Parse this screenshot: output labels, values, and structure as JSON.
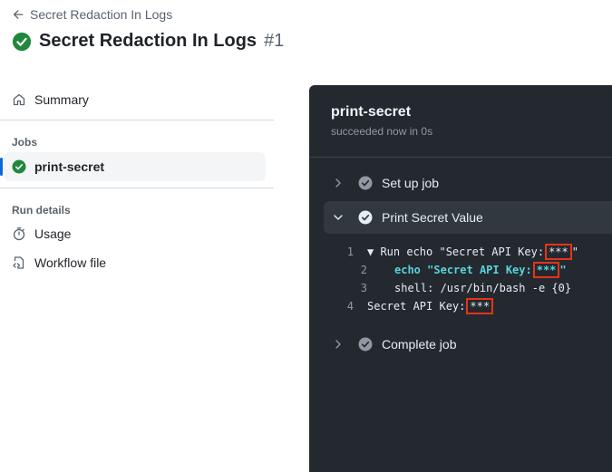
{
  "header": {
    "back_label": "Secret Redaction In Logs",
    "title": "Secret Redaction In Logs",
    "run_number": "#1"
  },
  "sidebar": {
    "summary_label": "Summary",
    "jobs_label": "Jobs",
    "job_name": "print-secret",
    "run_details_label": "Run details",
    "usage_label": "Usage",
    "workflow_file_label": "Workflow file"
  },
  "panel": {
    "job_title": "print-secret",
    "job_status": "succeeded now in 0s",
    "steps": [
      {
        "label": "Set up job",
        "expanded": false
      },
      {
        "label": "Print Secret Value",
        "expanded": true
      },
      {
        "label": "Complete job",
        "expanded": false
      }
    ],
    "log": [
      {
        "num": "1",
        "prefix": "▼ Run echo \"Secret API Key:",
        "masked": "***",
        "suffix": "\""
      },
      {
        "num": "2",
        "cmd": "echo",
        "str_prefix": "\"Secret API Key:",
        "masked": "***",
        "suffix": "\""
      },
      {
        "num": "3",
        "text": "shell: /usr/bin/bash -e {0}"
      },
      {
        "num": "4",
        "prefix": "Secret API Key:",
        "masked": "***"
      }
    ]
  },
  "colors": {
    "success_green": "#1f883d",
    "panel_bg": "#24292f",
    "highlight_red": "#e5331b",
    "accent_blue": "#0969da"
  }
}
